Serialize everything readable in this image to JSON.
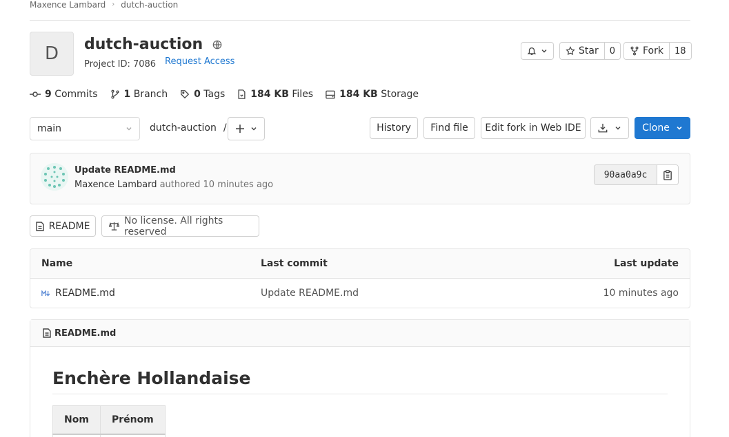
{
  "breadcrumb": {
    "owner": "Maxence Lambard",
    "separator": "›",
    "project": "dutch-auction"
  },
  "project": {
    "avatar_letter": "D",
    "name": "dutch-auction",
    "id_label": "Project ID: 7086",
    "request_access": "Request Access"
  },
  "actions": {
    "star_label": "Star",
    "star_count": "0",
    "fork_label": "Fork",
    "fork_count": "18"
  },
  "stats": {
    "commits_count": "9",
    "commits_label": "Commits",
    "branch_count": "1",
    "branch_label": "Branch",
    "tags_count": "0",
    "tags_label": "Tags",
    "files_size": "184 KB",
    "files_label": "Files",
    "storage_size": "184 KB",
    "storage_label": "Storage"
  },
  "toolbar": {
    "branch": "main",
    "path_root": "dutch-auction",
    "path_sep": "/",
    "history": "History",
    "find_file": "Find file",
    "edit_ide": "Edit fork in Web IDE",
    "clone": "Clone"
  },
  "commit": {
    "title": "Update README.md",
    "author": "Maxence Lambard",
    "authored_text": "authored 10 minutes ago",
    "sha": "90aa0a9c"
  },
  "badges": {
    "readme": "README",
    "license": "No license. All rights reserved"
  },
  "files": {
    "headers": {
      "name": "Name",
      "last_commit": "Last commit",
      "last_update": "Last update"
    },
    "rows": [
      {
        "name": "README.md",
        "last_commit": "Update README.md",
        "last_update": "10 minutes ago"
      }
    ]
  },
  "readme": {
    "file_name": "README.md",
    "heading": "Enchère Hollandaise",
    "table_headers": [
      "Nom",
      "Prénom"
    ]
  },
  "colors": {
    "accent": "#1f78d1",
    "text": "#303030",
    "muted": "#707070"
  }
}
